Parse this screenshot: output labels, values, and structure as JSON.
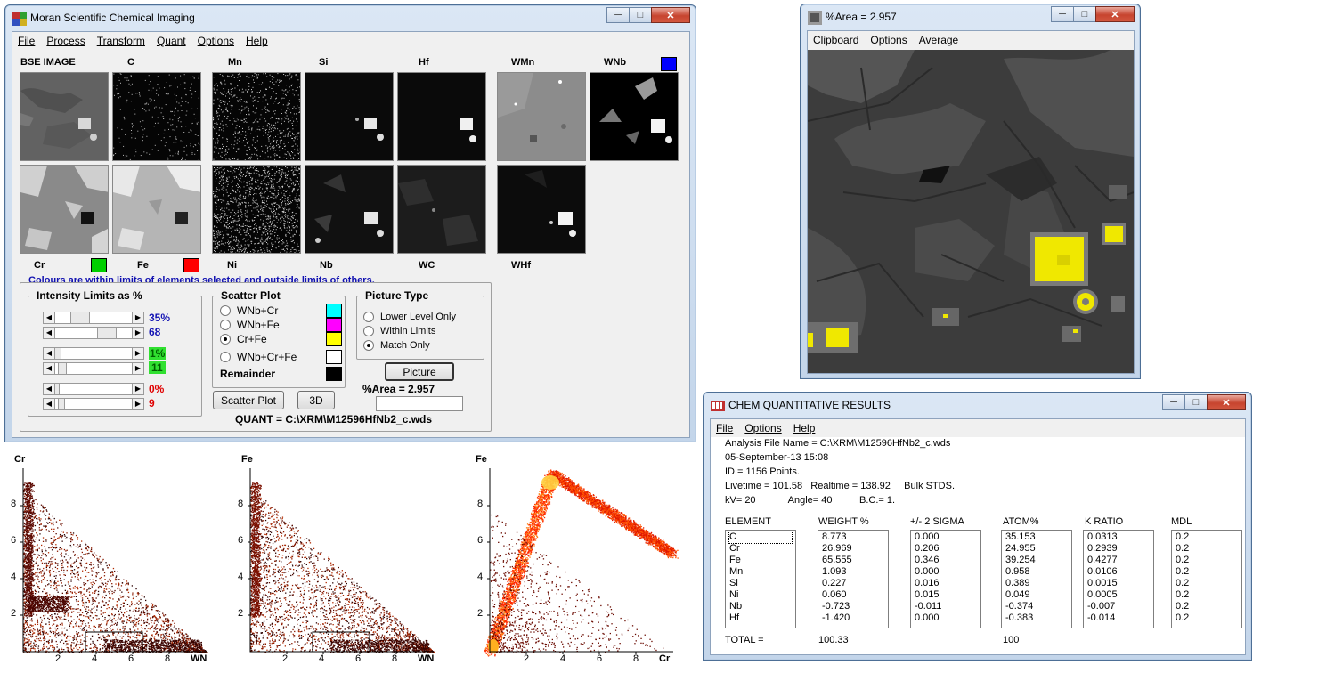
{
  "main_window": {
    "title": "Moran Scientific Chemical Imaging",
    "menu": [
      "File",
      "Process",
      "Transform",
      "Quant",
      "Options",
      "Help"
    ],
    "top_labels": [
      "BSE IMAGE",
      "C",
      "Mn",
      "Si",
      "Hf",
      "WMn",
      "WNb"
    ],
    "bottom_labels": [
      "Cr",
      "Fe",
      "Ni",
      "Nb",
      "WC",
      "WHf"
    ],
    "colours_note": "Colours are within limits of elements selected and outside limits of others.",
    "intensity": {
      "title": "Intensity Limits as %",
      "values": [
        "35%",
        "68",
        "1%",
        "11",
        "0%",
        "9"
      ]
    },
    "scatter": {
      "title": "Scatter Plot",
      "options": [
        "WNb+Cr",
        "WNb+Fe",
        "Cr+Fe",
        "WNb+Cr+Fe"
      ],
      "remainder": "Remainder",
      "selected": "Cr+Fe"
    },
    "picture_type": {
      "title": "Picture Type",
      "options": [
        "Lower Level Only",
        "Within Limits",
        "Match Only"
      ],
      "selected": "Match Only"
    },
    "buttons": {
      "picture": "Picture",
      "scatter_plot": "Scatter Plot",
      "three_d": "3D"
    },
    "area_label": "%Area = 2.957",
    "quant": "QUANT = C:\\XRM\\M12596HfNb2_c.wds",
    "colors": {
      "wnb": "#0000ff",
      "cr": "#00d000",
      "fe": "#ff0000",
      "wnb_cr": "#00ffff",
      "wnb_fe": "#ff00ff",
      "cr_fe": "#ffff00",
      "wnb_cr_fe": "#ffffff",
      "remainder": "#000000"
    }
  },
  "area_window": {
    "title": "%Area = 2.957",
    "menu": [
      "Clipboard",
      "Options",
      "Average"
    ]
  },
  "results_window": {
    "title": "CHEM QUANTITATIVE RESULTS",
    "menu": [
      "File",
      "Options",
      "Help"
    ],
    "lines": [
      "Analysis File Name = C:\\XRM\\M12596HfNb2_c.wds",
      "05-September-13   15:08",
      "ID = 1156 Points.",
      "Livetime = 101.58   Realtime = 138.92     Bulk STDS.",
      "kV= 20            Angle= 40          B.C.= 1."
    ],
    "headers": [
      "ELEMENT",
      "WEIGHT %",
      "+/- 2 SIGMA",
      "ATOM%",
      "K RATIO",
      "MDL"
    ],
    "elements": [
      "C",
      "Cr",
      "Fe",
      "Mn",
      "Si",
      "Ni",
      "Nb",
      "Hf"
    ],
    "weight": [
      "8.773",
      "26.969",
      "65.555",
      "1.093",
      "0.227",
      "0.060",
      "-0.723",
      "-1.420"
    ],
    "sigma": [
      "0.000",
      "0.206",
      "0.346",
      "0.000",
      "0.016",
      "0.015",
      "-0.011",
      "0.000"
    ],
    "atom": [
      "35.153",
      "24.955",
      "39.254",
      "0.958",
      "0.389",
      "0.049",
      "-0.374",
      "-0.383"
    ],
    "kratio": [
      "0.0313",
      "0.2939",
      "0.4277",
      "0.0106",
      "0.0015",
      "0.0005",
      "-0.007",
      "-0.014"
    ],
    "mdl": [
      "0.2",
      "0.2",
      "0.2",
      "0.2",
      "0.2",
      "0.2",
      "0.2",
      "0.2"
    ],
    "total_label": "TOTAL =",
    "total_weight": "100.33",
    "total_atom": "100"
  },
  "plots": [
    {
      "ylabel": "Cr",
      "xlabel": "WN",
      "yticks": [
        "2",
        "4",
        "6",
        "8"
      ],
      "xticks": [
        "2",
        "4",
        "6",
        "8"
      ]
    },
    {
      "ylabel": "Fe",
      "xlabel": "WN",
      "yticks": [
        "2",
        "4",
        "6",
        "8"
      ],
      "xticks": [
        "2",
        "4",
        "6",
        "8"
      ]
    },
    {
      "ylabel": "Fe",
      "xlabel": "Cr",
      "yticks": [
        "2",
        "4",
        "6",
        "8"
      ],
      "xticks": [
        "2",
        "4",
        "6",
        "8"
      ]
    }
  ]
}
